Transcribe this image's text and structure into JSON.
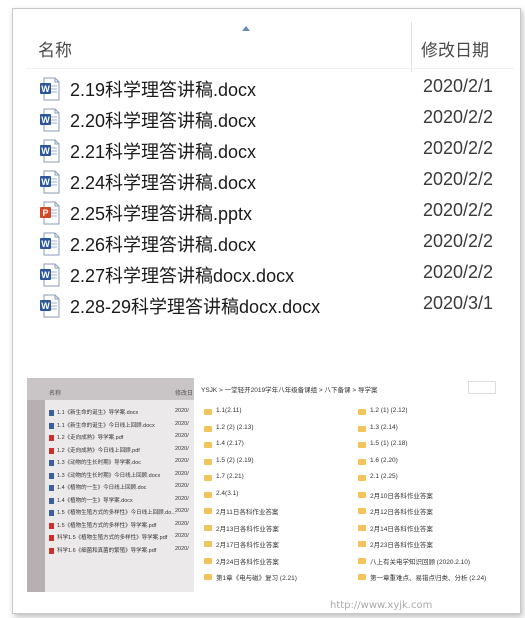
{
  "header": {
    "name_label": "名称",
    "date_label": "修改日期"
  },
  "files": [
    {
      "name": "2.19科学理答讲稿.docx",
      "date": "2020/2/1",
      "icon": "word-doc-icon"
    },
    {
      "name": "2.20科学理答讲稿.docx",
      "date": "2020/2/2",
      "icon": "word-doc-icon"
    },
    {
      "name": "2.21科学理答讲稿.docx",
      "date": "2020/2/2",
      "icon": "word-doc-icon"
    },
    {
      "name": "2.24科学理答讲稿.docx",
      "date": "2020/2/2",
      "icon": "word-doc-icon"
    },
    {
      "name": "2.25科学理答讲稿.pptx",
      "date": "2020/2/2",
      "icon": "powerpoint-icon"
    },
    {
      "name": "2.26科学理答讲稿.docx",
      "date": "2020/2/2",
      "icon": "word-doc-icon"
    },
    {
      "name": "2.27科学理答讲稿docx.docx",
      "date": "2020/2/2",
      "icon": "word-doc-icon"
    },
    {
      "name": "2.28-29科学理答讲稿docx.docx",
      "date": "2020/3/1",
      "icon": "word-doc-icon"
    }
  ],
  "photo": {
    "header_name": "名称",
    "header_date": "修改日",
    "rows": [
      {
        "text": "1.1《新生命的诞生》导学案.docx",
        "date": "2020/",
        "type": "doc"
      },
      {
        "text": "1.1《新生命的诞生》今日线上回顾.docx",
        "date": "2020/",
        "type": "doc"
      },
      {
        "text": "1.2《走向成熟》导学案.pdf",
        "date": "2020/",
        "type": "pdf"
      },
      {
        "text": "1.2《走向成熟》今日线上回顾.pdf",
        "date": "2020/",
        "type": "pdf"
      },
      {
        "text": "1.3《动物的生长时期》导学案.doc",
        "date": "2020/",
        "type": "doc"
      },
      {
        "text": "1.3《动物的生长时期》今日线上回顾.docx",
        "date": "2020/",
        "type": "doc"
      },
      {
        "text": "1.4《植物的一生》今日线上回顾.doc",
        "date": "2020/",
        "type": "doc"
      },
      {
        "text": "1.4《植物的一生》导学案.docx",
        "date": "2020/",
        "type": "doc"
      },
      {
        "text": "1.5《植物生殖方式的多样性》今日线上回顾.do...",
        "date": "2020/",
        "type": "doc"
      },
      {
        "text": "1.5《植物生殖方式的多样性》导学案.pdf",
        "date": "2020/",
        "type": "pdf"
      },
      {
        "text": "科学1.5《植物生殖方式的多样性》导学案.pdf",
        "date": "2020/",
        "type": "pdf"
      },
      {
        "text": "科学1.6《细菌和真菌的繁殖》导学案.pdf",
        "date": "2020/",
        "type": "pdf"
      }
    ]
  },
  "folder_view": {
    "breadcrumb": "YSJK  >  一堂轻开2019学年八年级备课组  >  八下备课  >  导学案",
    "folders": [
      {
        "left": "1.1(2.11)",
        "right": "1.2 (1)  (2.12)"
      },
      {
        "left": "1.2 (2)  (2.13)",
        "right": "1.3 (2.14)"
      },
      {
        "left": "1.4 (2.17)",
        "right": "1.5 (1)  (2.18)"
      },
      {
        "left": "1.5 (2)  (2.19)",
        "right": "1.6 (2.20)"
      },
      {
        "left": "1.7 (2.21)",
        "right": "2.1 (2.25)"
      },
      {
        "left": "2.4(3.1)",
        "right": "2月10日各科作业答案"
      },
      {
        "left": "2月11日各科作业答案",
        "right": "2月12日各科作业答案"
      },
      {
        "left": "2月13日各科作业答案",
        "right": "2月14日各科作业答案"
      },
      {
        "left": "2月17日各科作业答案",
        "right": "2月23日各科作业答案"
      },
      {
        "left": "2月24日各科作业答案",
        "right": "八上有关电学知识回顾 (2020.2.10)"
      },
      {
        "left": "第1章《电与磁》复习 (2.21)",
        "right": "第一章重难点、易错点归类、分析 (2.24)"
      }
    ]
  },
  "watermark": "http://www.xyjk.com",
  "colors": {
    "word_blue": "#2b579a",
    "ppt_red": "#d24726",
    "folder_yellow": "#f2c55c"
  }
}
